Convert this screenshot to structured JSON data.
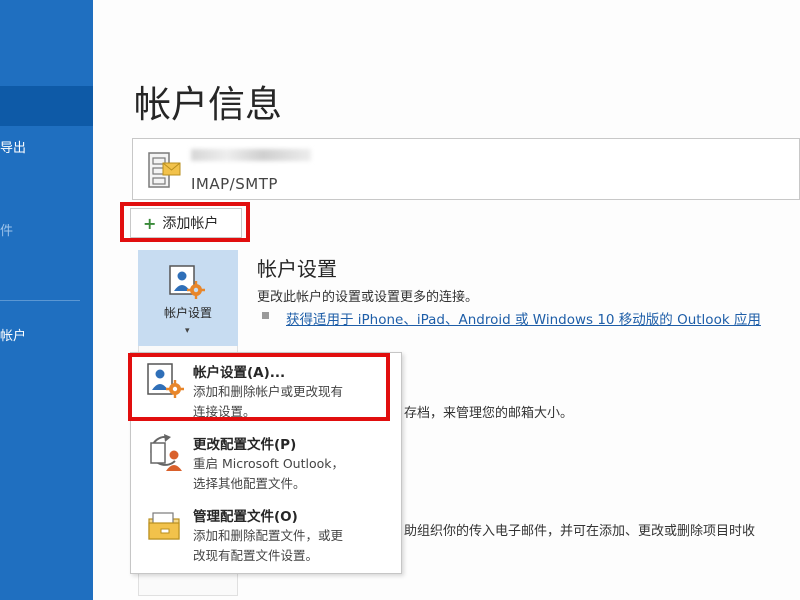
{
  "nav": {
    "items": [
      {
        "label": "导出",
        "dim": false
      },
      {
        "label": "件",
        "dim": true
      },
      {
        "label": "帐户",
        "dim": false
      }
    ]
  },
  "page": {
    "title": "帐户信息"
  },
  "account": {
    "type": "IMAP/SMTP"
  },
  "add_account": {
    "plus": "+",
    "label": "添加帐户"
  },
  "account_settings": {
    "button_label": "帐户设置",
    "caret": "▾",
    "title": "帐户设置",
    "description": "更改此帐户的设置或设置更多的连接。",
    "link": "获得适用于 iPhone、iPad、Android 或 Windows 10 移动版的 Outlook 应用"
  },
  "background_text": {
    "line1": "存档，来管理您的邮箱大小。",
    "line2": "助组织你的传入电子邮件，并可在添加、更改或删除项目时收"
  },
  "menu": {
    "items": [
      {
        "title": "帐户设置(A)...",
        "desc1": "添加和删除帐户或更改现有",
        "desc2": "连接设置。"
      },
      {
        "title": "更改配置文件(P)",
        "desc1": "重启 Microsoft Outlook，",
        "desc2": "选择其他配置文件。"
      },
      {
        "title": "管理配置文件(O)",
        "desc1": "添加和删除配置文件，或更",
        "desc2": "改现有配置文件设置。"
      }
    ]
  },
  "colors": {
    "nav_bg": "#1f6fc0",
    "highlight": "#e10e0e",
    "link": "#1e5ea8",
    "button_bg": "#c7dcf1"
  }
}
